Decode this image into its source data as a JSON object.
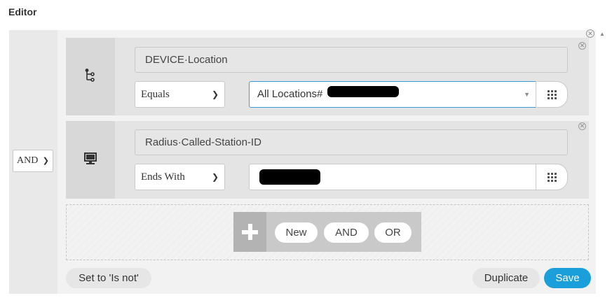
{
  "editor": {
    "title": "Editor"
  },
  "root_operator": {
    "value": "AND"
  },
  "conditions": [
    {
      "icon": "location-tree-icon",
      "attribute": "DEVICE·Location",
      "operator": "Equals",
      "value": "All Locations#",
      "value_redacted": true,
      "focused": true
    },
    {
      "icon": "computer-icon",
      "attribute": "Radius·Called-Station-ID",
      "operator": "Ends With",
      "value": "",
      "value_redacted": true,
      "focused": false
    }
  ],
  "add_bar": {
    "new_label": "New",
    "and_label": "AND",
    "or_label": "OR"
  },
  "footer": {
    "set_not_label": "Set to 'Is not'",
    "duplicate_label": "Duplicate",
    "save_label": "Save"
  },
  "colors": {
    "accent": "#1b9fdb",
    "focus": "#3a9cd6"
  }
}
